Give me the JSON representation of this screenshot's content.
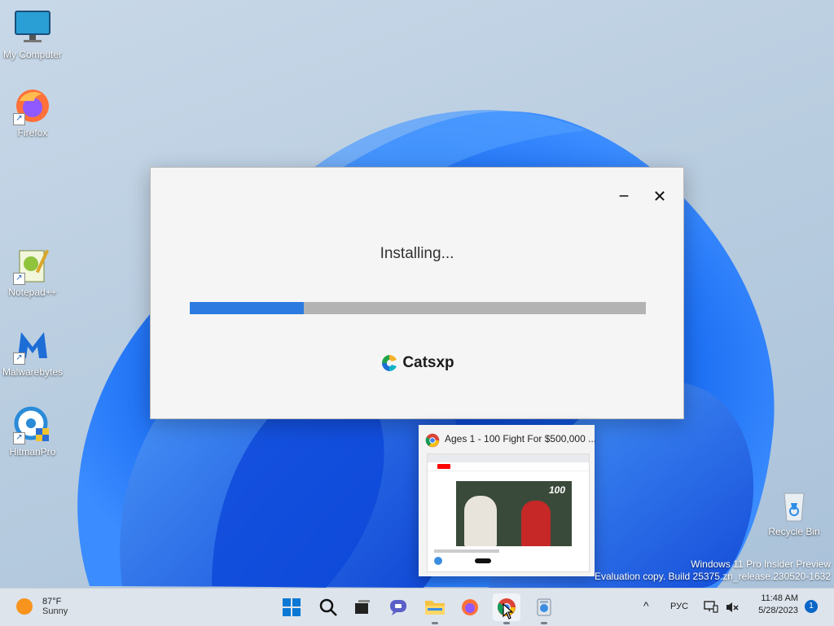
{
  "desktop": {
    "icons": [
      {
        "label": "My Computer"
      },
      {
        "label": "Firefox"
      },
      {
        "label": "Notepad++"
      },
      {
        "label": "Malwarebytes"
      },
      {
        "label": "HitmanPro"
      },
      {
        "label": "Recycle Bin"
      }
    ]
  },
  "installer": {
    "status": "Installing...",
    "progress_percent": 25,
    "brand_name": "Catsxp",
    "minimize_label": "−",
    "close_label": "✕",
    "accent_color": "#2b7be0"
  },
  "chrome_preview": {
    "title": "Ages 1 - 100 Fight For $500,000 ...",
    "thumb_overlay": "100"
  },
  "watermark": {
    "line1": "Windows 11 Pro Insider Preview",
    "line2": "Evaluation copy. Build 25375.zn_release.230520-1632"
  },
  "taskbar": {
    "weather": {
      "temp": "87°F",
      "condition": "Sunny"
    },
    "apps": [
      {
        "name": "start-icon"
      },
      {
        "name": "search-icon"
      },
      {
        "name": "task-view-icon"
      },
      {
        "name": "chat-icon"
      },
      {
        "name": "file-explorer-icon"
      },
      {
        "name": "firefox-icon"
      },
      {
        "name": "chrome-icon"
      },
      {
        "name": "setup-app-icon"
      }
    ],
    "tray": {
      "chevron": "^",
      "language": "РУС",
      "time": "11:48 AM",
      "date": "5/28/2023",
      "notification_count": "1"
    }
  }
}
